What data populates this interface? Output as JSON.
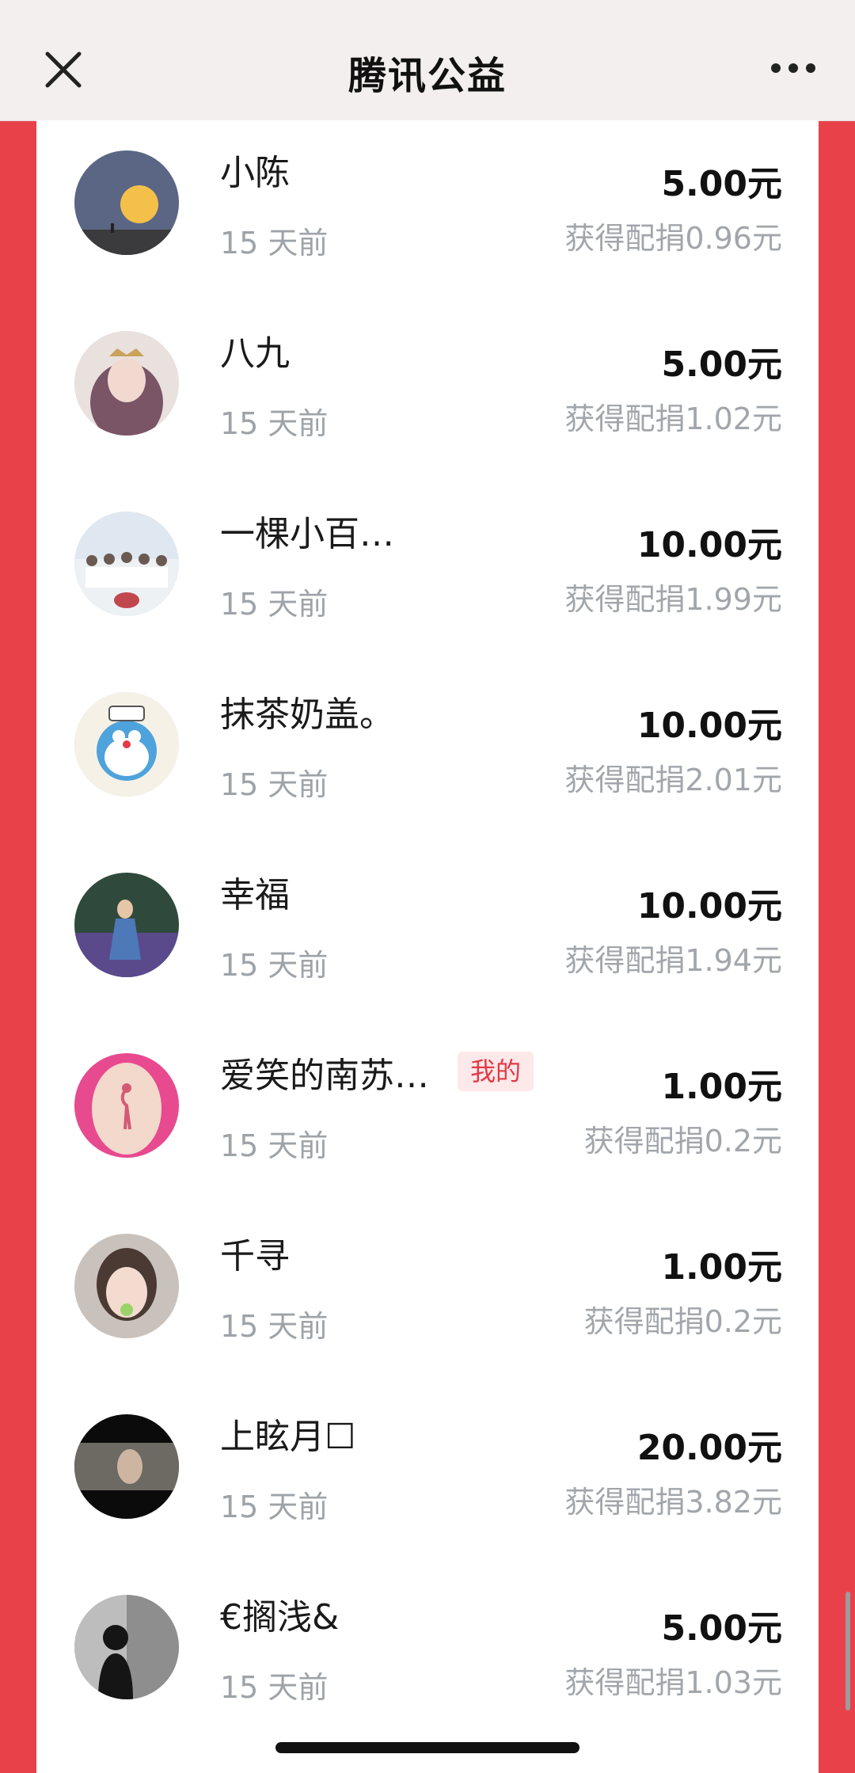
{
  "nav": {
    "title": "腾讯公益",
    "close_icon": "close-icon",
    "more_icon": "more-icon"
  },
  "donations": [
    {
      "name": "小陈",
      "time": "15 天前",
      "amount": "5.00元",
      "match": "获得配捐0.96元",
      "avatar": "moon"
    },
    {
      "name": "八九",
      "time": "15 天前",
      "amount": "5.00元",
      "match": "获得配捐1.02元",
      "avatar": "girl-crown"
    },
    {
      "name": "一棵小百…",
      "time": "15 天前",
      "amount": "10.00元",
      "match": "获得配捐1.99元",
      "avatar": "group-photo"
    },
    {
      "name": "抹茶奶盖。",
      "time": "15 天前",
      "amount": "10.00元",
      "match": "获得配捐2.01元",
      "avatar": "doraemon"
    },
    {
      "name": "幸福",
      "time": "15 天前",
      "amount": "10.00元",
      "match": "获得配捐1.94元",
      "avatar": "lavender-field"
    },
    {
      "name": "爱笑的南苏…",
      "time": "15 天前",
      "amount": "1.00元",
      "match": "获得配捐0.2元",
      "avatar": "flamingo-tattoo",
      "tag": "我的"
    },
    {
      "name": "千寻",
      "time": "15 天前",
      "amount": "1.00元",
      "match": "获得配捐0.2元",
      "avatar": "child-portrait"
    },
    {
      "name": "上眩月☐",
      "time": "15 天前",
      "amount": "20.00元",
      "match": "获得配捐3.82元",
      "avatar": "dark-portrait"
    },
    {
      "name": "€搁浅&",
      "time": "15 天前",
      "amount": "5.00元",
      "match": "获得配捐1.03元",
      "avatar": "silhouette"
    }
  ],
  "colors": {
    "page_background": "#e8414a",
    "nav_background": "#f3efef",
    "tag_text": "#e23b46",
    "tag_background": "#fde8ea"
  }
}
